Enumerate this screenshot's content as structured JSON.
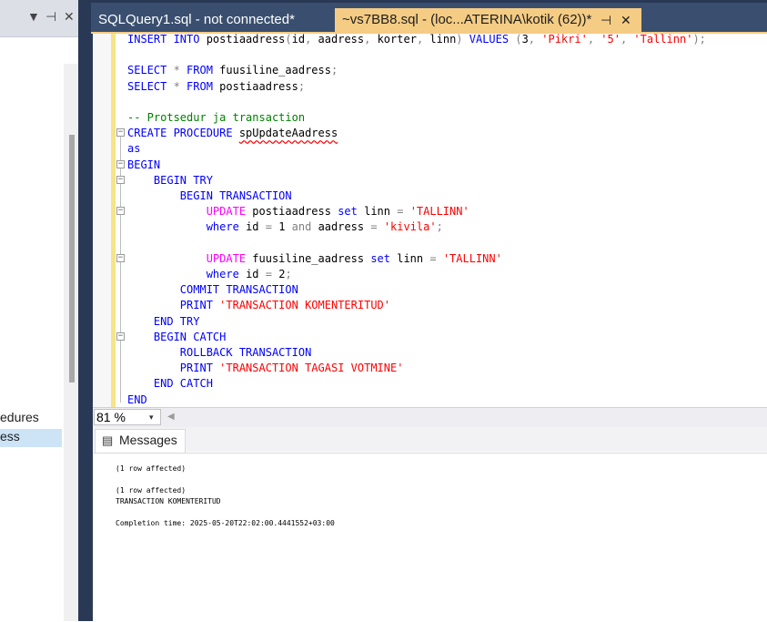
{
  "left_panel": {
    "controls": {
      "dropdown": "▼",
      "pin": "⊣",
      "close": "✕"
    },
    "tree_items": [
      "edures",
      "ess"
    ]
  },
  "tabs": [
    {
      "label": "SQLQuery1.sql - not connected*"
    },
    {
      "label": "~vs7BB8.sql - (loc...ATERINA\\kotik (62))*",
      "pin": "⊣",
      "close": "✕"
    }
  ],
  "editor": {
    "lines": [
      {
        "parts": [
          [
            "kw",
            "INSERT INTO "
          ],
          [
            "",
            "postiaadress"
          ],
          [
            "gr",
            "("
          ],
          [
            "",
            "id"
          ],
          [
            "gr",
            ", "
          ],
          [
            "",
            "aadress"
          ],
          [
            "gr",
            ", "
          ],
          [
            "",
            "korter"
          ],
          [
            "gr",
            ", "
          ],
          [
            "",
            "linn"
          ],
          [
            "gr",
            ") "
          ],
          [
            "kw",
            "VALUES "
          ],
          [
            "gr",
            "("
          ],
          [
            "",
            "3"
          ],
          [
            "gr",
            ", "
          ],
          [
            "str",
            "'Pikri'"
          ],
          [
            "gr",
            ", "
          ],
          [
            "str",
            "'5'"
          ],
          [
            "gr",
            ", "
          ],
          [
            "str",
            "'Tallinn'"
          ],
          [
            "gr",
            ");"
          ]
        ]
      },
      {
        "parts": []
      },
      {
        "parts": [
          [
            "kw",
            "SELECT "
          ],
          [
            "gr",
            "* "
          ],
          [
            "kw",
            "FROM "
          ],
          [
            "",
            "fuusiline_aadress"
          ],
          [
            "gr",
            ";"
          ]
        ]
      },
      {
        "parts": [
          [
            "kw",
            "SELECT "
          ],
          [
            "gr",
            "* "
          ],
          [
            "kw",
            "FROM "
          ],
          [
            "",
            "postiaadress"
          ],
          [
            "gr",
            ";"
          ]
        ]
      },
      {
        "parts": []
      },
      {
        "parts": [
          [
            "cm",
            "-- Protsedur ja transaction"
          ]
        ]
      },
      {
        "parts": [
          [
            "kw",
            "CREATE PROCEDURE "
          ],
          [
            "squig",
            "spUpdateAadress"
          ]
        ]
      },
      {
        "parts": [
          [
            "kw",
            "as"
          ]
        ]
      },
      {
        "parts": [
          [
            "kw",
            "BEGIN"
          ]
        ]
      },
      {
        "parts": [
          [
            "",
            "    "
          ],
          [
            "kw",
            "BEGIN TRY"
          ]
        ]
      },
      {
        "parts": [
          [
            "",
            "        "
          ],
          [
            "kw",
            "BEGIN TRANSACTION"
          ]
        ]
      },
      {
        "parts": [
          [
            "",
            "            "
          ],
          [
            "fn",
            "UPDATE "
          ],
          [
            "",
            "postiaadress "
          ],
          [
            "kw",
            "set "
          ],
          [
            "",
            "linn "
          ],
          [
            "gr",
            "= "
          ],
          [
            "str",
            "'TALLINN'"
          ]
        ]
      },
      {
        "parts": [
          [
            "",
            "            "
          ],
          [
            "kw",
            "where "
          ],
          [
            "",
            "id "
          ],
          [
            "gr",
            "= "
          ],
          [
            "",
            "1 "
          ],
          [
            "gr",
            "and "
          ],
          [
            "",
            "aadress "
          ],
          [
            "gr",
            "= "
          ],
          [
            "str",
            "'kivila'"
          ],
          [
            "gr",
            ";"
          ]
        ]
      },
      {
        "parts": []
      },
      {
        "parts": [
          [
            "",
            "            "
          ],
          [
            "fn",
            "UPDATE "
          ],
          [
            "",
            "fuusiline_aadress "
          ],
          [
            "kw",
            "set "
          ],
          [
            "",
            "linn "
          ],
          [
            "gr",
            "= "
          ],
          [
            "str",
            "'TALLINN'"
          ]
        ]
      },
      {
        "parts": [
          [
            "",
            "            "
          ],
          [
            "kw",
            "where "
          ],
          [
            "",
            "id "
          ],
          [
            "gr",
            "= "
          ],
          [
            "",
            "2"
          ],
          [
            "gr",
            ";"
          ]
        ]
      },
      {
        "parts": [
          [
            "",
            "        "
          ],
          [
            "kw",
            "COMMIT TRANSACTION"
          ]
        ]
      },
      {
        "parts": [
          [
            "",
            "        "
          ],
          [
            "kw",
            "PRINT "
          ],
          [
            "str",
            "'TRANSACTION KOMENTERITUD'"
          ]
        ]
      },
      {
        "parts": [
          [
            "",
            "    "
          ],
          [
            "kw",
            "END TRY"
          ]
        ]
      },
      {
        "parts": [
          [
            "",
            "    "
          ],
          [
            "kw",
            "BEGIN CATCH"
          ]
        ]
      },
      {
        "parts": [
          [
            "",
            "        "
          ],
          [
            "kw",
            "ROLLBACK TRANSACTION"
          ]
        ]
      },
      {
        "parts": [
          [
            "",
            "        "
          ],
          [
            "kw",
            "PRINT "
          ],
          [
            "str",
            "'TRANSACTION TAGASI VOTMINE'"
          ]
        ]
      },
      {
        "parts": [
          [
            "",
            "    "
          ],
          [
            "kw",
            "END CATCH"
          ]
        ]
      },
      {
        "parts": [
          [
            "kw",
            "END"
          ]
        ]
      }
    ]
  },
  "zoom": {
    "value": "81 %",
    "arrow": "▾",
    "scroll_left": "◀"
  },
  "results": {
    "tab_label": "Messages",
    "messages": [
      "(1 row affected)",
      "",
      "(1 row affected)",
      "TRANSACTION KOMENTERITUD",
      "",
      "Completion time: 2025-05-20T22:02:00.4441552+03:00"
    ]
  },
  "colors": {
    "tab_bar": "#3a4f6f",
    "active_tab": "#f5cc84",
    "keyword": "#0000ff",
    "function": "#ff00ff",
    "string": "#ff0000",
    "comment": "#008000"
  }
}
